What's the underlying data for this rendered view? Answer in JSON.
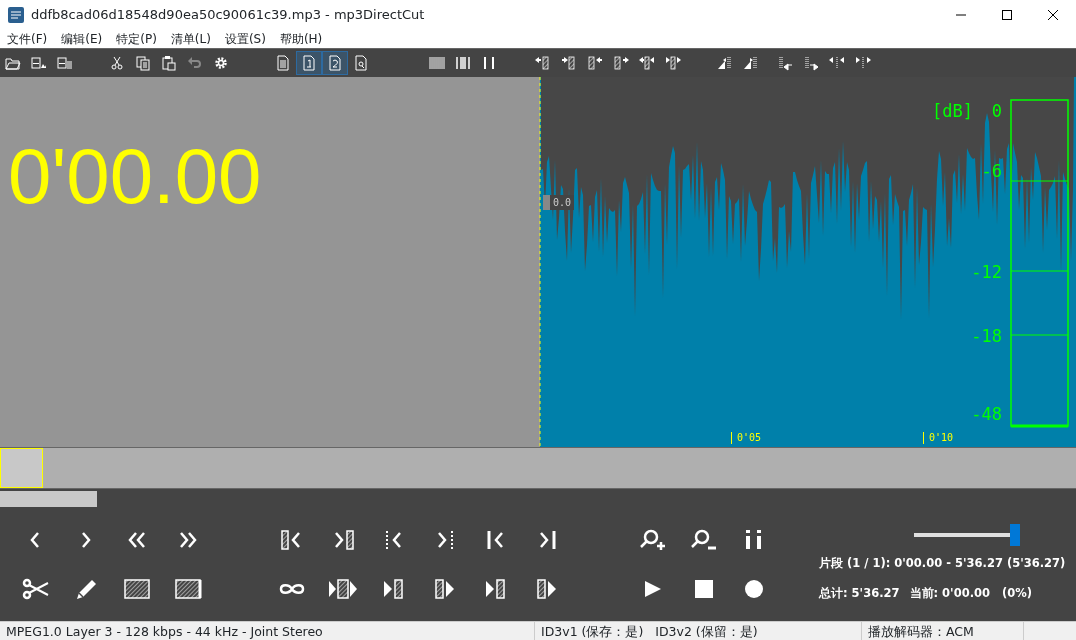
{
  "window": {
    "title": "ddfb8cad06d18548d90ea50c90061c39.mp3 - mp3DirectCut"
  },
  "menu": [
    "文件(F)",
    "编辑(E)",
    "特定(P)",
    "清单(L)",
    "设置(S)",
    "帮助(H)"
  ],
  "toolbar": [
    {
      "items": [
        {
          "kind": "open",
          "selected": false
        },
        {
          "kind": "save-wave",
          "selected": false
        },
        {
          "kind": "save-list",
          "selected": false
        }
      ]
    },
    {
      "items": [
        {
          "kind": "cut",
          "selected": false
        },
        {
          "kind": "copy",
          "selected": false
        },
        {
          "kind": "paste",
          "selected": false
        },
        {
          "kind": "undo",
          "selected": false,
          "disabled": true
        },
        {
          "kind": "gear",
          "selected": false
        }
      ]
    },
    {
      "items": [
        {
          "kind": "page",
          "selected": false
        },
        {
          "kind": "page-1",
          "selected": true
        },
        {
          "kind": "page-2",
          "selected": true
        },
        {
          "kind": "page-find",
          "selected": false
        }
      ]
    },
    {
      "items": [
        {
          "kind": "bars-3",
          "selected": false
        },
        {
          "kind": "bars-2",
          "selected": false
        },
        {
          "kind": "bars-1",
          "selected": false
        }
      ]
    },
    {
      "items": [
        {
          "kind": "arrow-bar-l",
          "selected": false
        },
        {
          "kind": "arrow-bar-r",
          "selected": false
        },
        {
          "kind": "bar-arrow-l",
          "selected": false
        },
        {
          "kind": "bar-arrow-r",
          "selected": false
        },
        {
          "kind": "arrows-bar-l",
          "selected": false
        },
        {
          "kind": "arrows-bar-r",
          "selected": false
        }
      ]
    },
    {
      "items": [
        {
          "kind": "ramp-down",
          "selected": false
        },
        {
          "kind": "ramp-up",
          "selected": false
        }
      ]
    },
    {
      "items": [
        {
          "kind": "dots-in",
          "selected": false
        },
        {
          "kind": "dots-out",
          "selected": false
        },
        {
          "kind": "dots-l",
          "selected": false
        },
        {
          "kind": "dots-r",
          "selected": false
        }
      ]
    }
  ],
  "time_display": "0'00.00",
  "waveform": {
    "cursor_label": "0.0",
    "time_marks": [
      "0'05",
      "0'10"
    ],
    "db_unit": "[dB]",
    "db_labels": [
      "0",
      "-6",
      "-12",
      "-18",
      "-48"
    ]
  },
  "overview": {
    "level": 0.04
  },
  "scroll": {
    "level": 0.09
  },
  "controls": [
    [
      {
        "items": [
          {
            "kind": "prev"
          },
          {
            "kind": "next"
          },
          {
            "kind": "rew"
          },
          {
            "kind": "ffw"
          }
        ]
      },
      {
        "items": [
          {
            "kind": "hatch-left"
          },
          {
            "kind": "hatch-right"
          },
          {
            "kind": "dots-left"
          },
          {
            "kind": "dots-right"
          },
          {
            "kind": "bar-left"
          },
          {
            "kind": "bar-right"
          }
        ]
      },
      {
        "items": [
          {
            "kind": "zoom-in"
          },
          {
            "kind": "zoom-out"
          },
          {
            "kind": "info"
          }
        ]
      }
    ],
    [
      {
        "items": [
          {
            "kind": "scissors"
          },
          {
            "kind": "pencil"
          },
          {
            "kind": "hatch"
          },
          {
            "kind": "hatch-2"
          }
        ]
      },
      {
        "items": [
          {
            "kind": "loop"
          },
          {
            "kind": "play-sel"
          },
          {
            "kind": "play-hatch"
          },
          {
            "kind": "hatch-play"
          },
          {
            "kind": "play-hatch-2"
          },
          {
            "kind": "hatch-play-2"
          }
        ]
      },
      {
        "items": [
          {
            "kind": "play"
          },
          {
            "kind": "stop"
          },
          {
            "kind": "record"
          }
        ]
      }
    ]
  ],
  "volume": {
    "level": 0.96
  },
  "info": {
    "segment": "片段 (1 / 1): 0'00.00 - 5'36.27 (5'36.27)",
    "total": "总计: 5'36.27",
    "current": "当前: 0'00.00   (0%)"
  },
  "status_bar": [
    "MPEG1.0 Layer 3 - 128 kbps - 44 kHz - Joint Stereo",
    "ID3v1 (保存：是)   ID3v2 (保留：是)",
    "播放解码器：ACM"
  ]
}
